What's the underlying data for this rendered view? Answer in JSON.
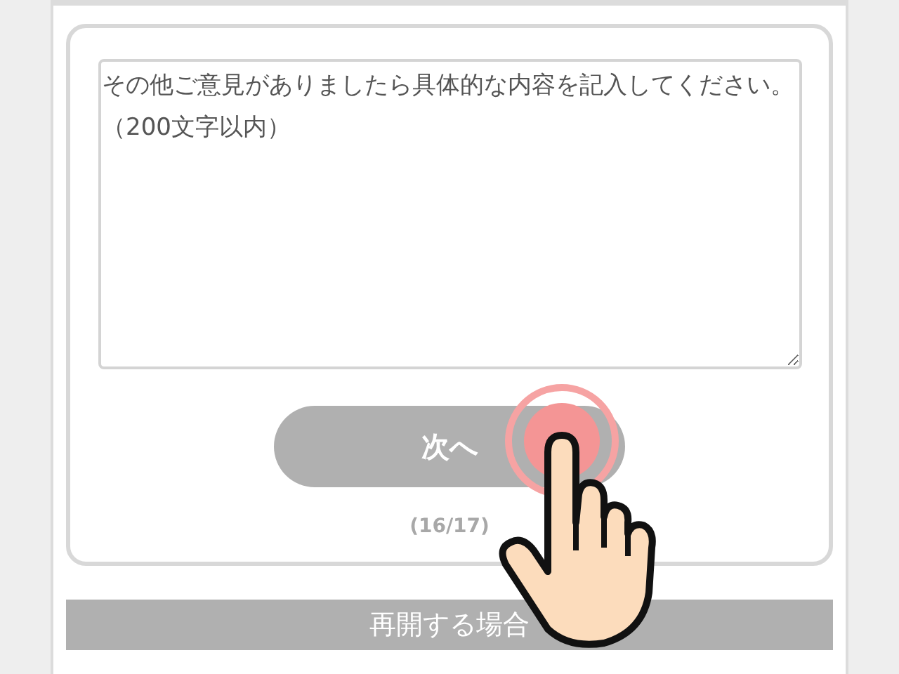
{
  "comment_field": {
    "value": "その他ご意見がありましたら具体的な内容を記入してください。（200文字以内）"
  },
  "next_button": {
    "label": "次へ"
  },
  "progress": "(16/17)",
  "resume_bar": {
    "label": "再開する場合"
  }
}
